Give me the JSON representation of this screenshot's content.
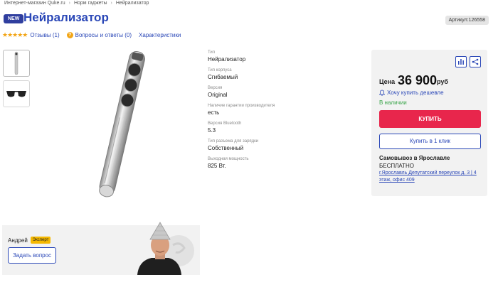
{
  "breadcrumbs": [
    "Интернет-магазин Quke.ru",
    "Норм гаджеты",
    "Нейрализатор"
  ],
  "breadcrumb_separator": "›",
  "badge": "NEW",
  "title": "Нейрализатор",
  "sku": "Артикул:126558",
  "subnav": {
    "stars": "★★★★★",
    "reviews": "Отзывы (1)",
    "qa": "Вопросы и ответы (0)",
    "specs": "Характеристики"
  },
  "specs": [
    {
      "label": "Тип",
      "value": "Нейрализатор"
    },
    {
      "label": "Тип корпуса",
      "value": "Сгибаемый"
    },
    {
      "label": "Версия",
      "value": "Original"
    },
    {
      "label": "Наличие гарантии производителя",
      "value": "есть"
    },
    {
      "label": "Версия Bluetooth",
      "value": "5.3"
    },
    {
      "label": "Тип разъема для зарядки",
      "value": "Собственный"
    },
    {
      "label": "Выходная мощность",
      "value": "825 Вт."
    }
  ],
  "buybox": {
    "price_label": "Цена",
    "price": "36 900",
    "currency": "руб",
    "cheaper": "Хочу купить дешевле",
    "stock": "В наличии",
    "buy": "КУПИТЬ",
    "one_click": "Купить в 1 клик",
    "pickup": "Самовывоз в Ярославле",
    "pickup_price": "БЕСПЛАТНО",
    "address": "г.Ярославль Депутатский переулок д. 3 | 4 этаж, офис 409"
  },
  "expert": {
    "name": "Андрей",
    "tag": "Эксперт",
    "ask": "Задать вопрос"
  },
  "colors": {
    "brand": "#2a47b7",
    "buy": "#e8264c",
    "stock": "#3aa54a",
    "star": "#f2a516"
  }
}
